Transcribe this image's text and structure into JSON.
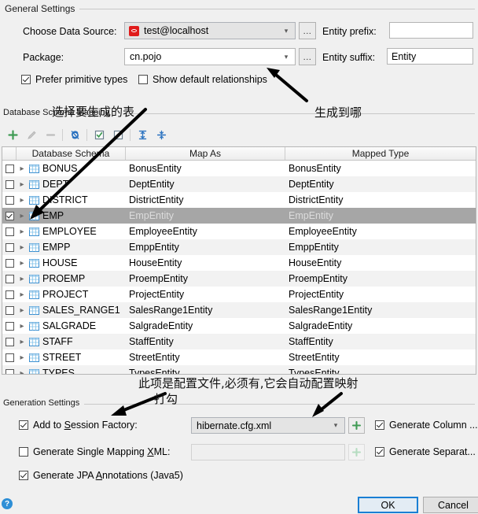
{
  "general": {
    "section_title": "General Settings",
    "data_source_label": "Choose Data Source:",
    "data_source_value": "test@localhost",
    "data_source_icon": "oracle-datasource-icon",
    "package_label": "Package:",
    "package_value": "cn.pojo",
    "ellipsis_label": "...",
    "entity_prefix_label": "Entity prefix:",
    "entity_prefix_value": "",
    "entity_suffix_label": "Entity suffix:",
    "entity_suffix_value": "Entity",
    "prefer_primitive_label": "Prefer primitive types",
    "prefer_primitive_checked": true,
    "show_default_rel_label": "Show default relationships",
    "show_default_rel_checked": false
  },
  "schema": {
    "section_title": "Database Schema Mapping",
    "toolbar": [
      {
        "name": "add-icon",
        "glyph": "+",
        "enabled": true
      },
      {
        "name": "edit-pencil-icon",
        "glyph": "✎",
        "enabled": false
      },
      {
        "name": "remove-icon",
        "glyph": "−",
        "enabled": false
      },
      {
        "name": "refresh-icon",
        "glyph": "↻",
        "enabled": true
      },
      {
        "name": "select-all-icon",
        "glyph": "☑",
        "enabled": true
      },
      {
        "name": "deselect-all-icon",
        "glyph": "☐",
        "enabled": true
      },
      {
        "name": "expand-all-icon",
        "glyph": "⇕",
        "enabled": true
      },
      {
        "name": "collapse-all-icon",
        "glyph": "⇵",
        "enabled": true
      }
    ],
    "columns": [
      "Database Schema",
      "Map As",
      "Mapped Type"
    ],
    "rows": [
      {
        "table": "BONUS",
        "map_as": "BonusEntity",
        "mapped_type": "BonusEntity",
        "checked": false,
        "selected": false
      },
      {
        "table": "DEPT",
        "map_as": "DeptEntity",
        "mapped_type": "DeptEntity",
        "checked": false,
        "selected": false
      },
      {
        "table": "DISTRICT",
        "map_as": "DistrictEntity",
        "mapped_type": "DistrictEntity",
        "checked": false,
        "selected": false
      },
      {
        "table": "EMP",
        "map_as": "EmpEntity",
        "mapped_type": "EmpEntity",
        "checked": true,
        "selected": true
      },
      {
        "table": "EMPLOYEE",
        "map_as": "EmployeeEntity",
        "mapped_type": "EmployeeEntity",
        "checked": false,
        "selected": false
      },
      {
        "table": "EMPP",
        "map_as": "EmppEntity",
        "mapped_type": "EmppEntity",
        "checked": false,
        "selected": false
      },
      {
        "table": "HOUSE",
        "map_as": "HouseEntity",
        "mapped_type": "HouseEntity",
        "checked": false,
        "selected": false
      },
      {
        "table": "PROEMP",
        "map_as": "ProempEntity",
        "mapped_type": "ProempEntity",
        "checked": false,
        "selected": false
      },
      {
        "table": "PROJECT",
        "map_as": "ProjectEntity",
        "mapped_type": "ProjectEntity",
        "checked": false,
        "selected": false
      },
      {
        "table": "SALES_RANGE1",
        "map_as": "SalesRange1Entity",
        "mapped_type": "SalesRange1Entity",
        "checked": false,
        "selected": false
      },
      {
        "table": "SALGRADE",
        "map_as": "SalgradeEntity",
        "mapped_type": "SalgradeEntity",
        "checked": false,
        "selected": false
      },
      {
        "table": "STAFF",
        "map_as": "StaffEntity",
        "mapped_type": "StaffEntity",
        "checked": false,
        "selected": false
      },
      {
        "table": "STREET",
        "map_as": "StreetEntity",
        "mapped_type": "StreetEntity",
        "checked": false,
        "selected": false
      },
      {
        "table": "TYPES",
        "map_as": "TypesEntity",
        "mapped_type": "TypesEntity",
        "checked": false,
        "selected": false
      }
    ]
  },
  "generation": {
    "section_title": "Generation Settings",
    "session_factory_label": "Add to Session Factory:",
    "session_factory_checked": true,
    "session_factory_value": "hibernate.cfg.xml",
    "single_mapping_label": "Generate Single Mapping XML:",
    "single_mapping_checked": false,
    "single_mapping_value": "",
    "generate_column_label": "Generate Column ...",
    "generate_column_checked": true,
    "generate_separate_label": "Generate Separat...",
    "generate_separate_checked": true,
    "jpa_label": "Generate JPA Annotations (Java5)",
    "jpa_checked": true,
    "plus_glyph": "+"
  },
  "footer": {
    "help_label": "?",
    "ok_label": "OK",
    "cancel_label": "Cancel"
  },
  "annotations": [
    {
      "name": "annotation-select-tables",
      "text": "选择要生成的表"
    },
    {
      "name": "annotation-generate-where",
      "text": "生成到哪"
    },
    {
      "name": "annotation-config-file",
      "text": "此项是配置文件,必须有,它会自动配置映射"
    },
    {
      "name": "annotation-check-it",
      "text": "打勾"
    }
  ],
  "colors": {
    "accent_blue": "#1a7fd4",
    "selection_gray": "#a6a6a6",
    "plus_green": "#3f9b54",
    "refresh_blue": "#2a72c0",
    "datasource_red": "#e01b1b"
  }
}
